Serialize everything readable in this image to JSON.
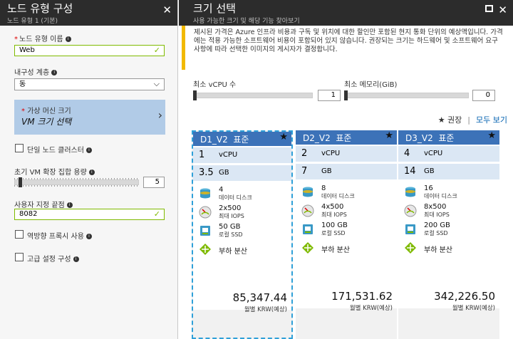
{
  "left": {
    "title": "노드 유형 구성",
    "subtitle": "노드 유형 1 (기본)",
    "name_label": "노드 유형 이름",
    "name_value": "Web",
    "durability_label": "내구성 계층",
    "durability_value": "동",
    "vm_size_label": "가상 머신 크기",
    "vm_size_value": "VM 크기 선택",
    "single_node_label": "단일 노드 클러스터",
    "vmss_label": "초기 VM 확장 집합 용량",
    "vmss_value": "5",
    "endpoint_label": "사용자 지정 끝점",
    "endpoint_value": "8082",
    "reverse_proxy_label": "역방향 프록시 사용",
    "advanced_label": "고급 설정 구성"
  },
  "right": {
    "title": "크기 선택",
    "subtitle": "사용 가능한 크기 및 해당 기능 찾아보기",
    "note": "제시된 가격은 Azure 인프라 비용과 구독 및 위치에 대한 할인만 포함된 현지 통화 단위의 예상액입니다. 가격에는 적용 가능한 소프트웨어 비용이 포함되어 있지 않습니다. 권장되는 크기는 하드웨어 및 소프트웨어 요구 사항에 따라 선택한 이미지의 게시자가 결정합니다.",
    "min_vcpu_label": "최소 vCPU 수",
    "min_vcpu_value": "1",
    "min_mem_label": "최소 메모리(GiB)",
    "min_mem_value": "0",
    "recommended": "★ 권장",
    "view_all": "모두 보기",
    "cards": [
      {
        "name": "D1_V2",
        "tier": "표준",
        "vcpu": "1",
        "vcpu_unit": "vCPU",
        "gb": "3.5",
        "gb_unit": "GB",
        "disks": "4",
        "disks_label": "데이터 디스크",
        "iops": "2x500",
        "iops_label": "최대 IOPS",
        "ssd": "50 GB",
        "ssd_label": "로컬 SSD",
        "lb": "부하 분산",
        "price": "85,347.44",
        "per": "월별 KRW(예상)"
      },
      {
        "name": "D2_V2",
        "tier": "표준",
        "vcpu": "2",
        "vcpu_unit": "vCPU",
        "gb": "7",
        "gb_unit": "GB",
        "disks": "8",
        "disks_label": "데이터 디스크",
        "iops": "4x500",
        "iops_label": "최대 IOPS",
        "ssd": "100 GB",
        "ssd_label": "로컬 SSD",
        "lb": "부하 분산",
        "price": "171,531.62",
        "per": "월별 KRW(예상)"
      },
      {
        "name": "D3_V2",
        "tier": "표준",
        "vcpu": "4",
        "vcpu_unit": "vCPU",
        "gb": "14",
        "gb_unit": "GB",
        "disks": "16",
        "disks_label": "데이터 디스크",
        "iops": "8x500",
        "iops_label": "최대 IOPS",
        "ssd": "200 GB",
        "ssd_label": "로컬 SSD",
        "lb": "부하 분산",
        "price": "342,226.50",
        "per": "월별 KRW(예상)"
      }
    ]
  },
  "colors": {
    "accent": "#3c72b8",
    "valid": "#7fba00",
    "warning": "#f2b900",
    "selected": "#b1cbe7"
  }
}
